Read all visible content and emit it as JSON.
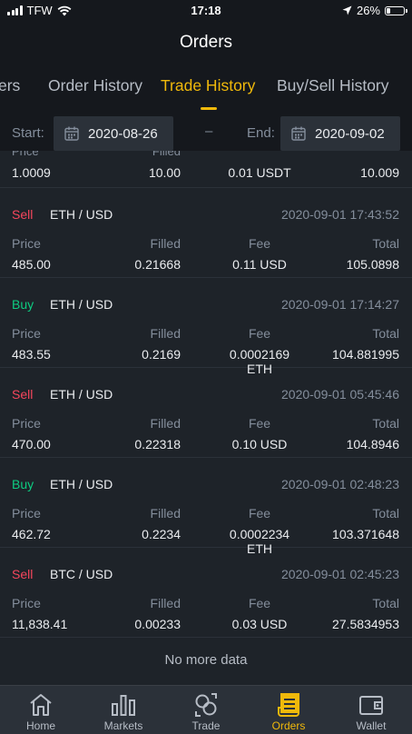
{
  "status_bar": {
    "carrier": "TFW",
    "time": "17:18",
    "battery": "26%",
    "battery_level": 0.26
  },
  "header": {
    "title": "Orders"
  },
  "tabs": [
    {
      "label": "ers",
      "active": false
    },
    {
      "label": "Order History",
      "active": false
    },
    {
      "label": "Trade History",
      "active": true
    },
    {
      "label": "Buy/Sell History",
      "active": false
    }
  ],
  "filter": {
    "start_label": "Start:",
    "start_date": "2020-08-26",
    "separator": "–",
    "end_label": "End:",
    "end_date": "2020-09-02"
  },
  "partial_trade": {
    "price": "1.0009",
    "filled": "10.00",
    "fee": "0.01 USDT",
    "total": "10.009"
  },
  "column_headers": {
    "price": "Price",
    "filled": "Filled",
    "fee": "Fee",
    "total": "Total"
  },
  "trades": [
    {
      "side": "Sell",
      "pair": "ETH / USD",
      "time": "2020-09-01 17:43:52",
      "price": "485.00",
      "filled": "0.21668",
      "fee": "0.11 USD",
      "total": "105.0898"
    },
    {
      "side": "Buy",
      "pair": "ETH / USD",
      "time": "2020-09-01 17:14:27",
      "price": "483.55",
      "filled": "0.2169",
      "fee": "0.0002169 ETH",
      "total": "104.881995"
    },
    {
      "side": "Sell",
      "pair": "ETH / USD",
      "time": "2020-09-01 05:45:46",
      "price": "470.00",
      "filled": "0.22318",
      "fee": "0.10 USD",
      "total": "104.8946"
    },
    {
      "side": "Buy",
      "pair": "ETH / USD",
      "time": "2020-09-01 02:48:23",
      "price": "462.72",
      "filled": "0.2234",
      "fee": "0.0002234 ETH",
      "total": "103.371648"
    },
    {
      "side": "Sell",
      "pair": "BTC / USD",
      "time": "2020-09-01 02:45:23",
      "price": "11,838.41",
      "filled": "0.00233",
      "fee": "0.03 USD",
      "total": "27.5834953"
    }
  ],
  "no_more": "No more data",
  "nav": [
    {
      "label": "Home",
      "icon": "home-icon",
      "active": false
    },
    {
      "label": "Markets",
      "icon": "markets-icon",
      "active": false
    },
    {
      "label": "Trade",
      "icon": "trade-icon",
      "active": false
    },
    {
      "label": "Orders",
      "icon": "orders-icon",
      "active": true
    },
    {
      "label": "Wallet",
      "icon": "wallet-icon",
      "active": false
    }
  ],
  "colors": {
    "accent": "#f0b90b",
    "sell": "#f6465d",
    "buy": "#0ecb81",
    "background": "#1e2329"
  }
}
